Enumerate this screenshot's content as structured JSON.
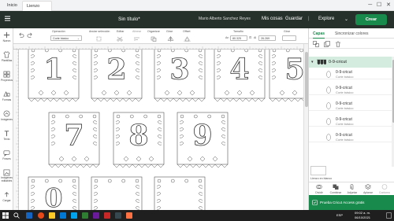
{
  "browser": {
    "tabs": [
      {
        "label": "Inicio"
      },
      {
        "label": "Lienzo"
      }
    ]
  },
  "header": {
    "title": "Sin título*",
    "my_projects": "Mis cosas",
    "save": "Guardar",
    "machine": "Explore",
    "make": "Crear",
    "user": "Mario Alberto Sanchez Reyes"
  },
  "colors": {
    "header_bg": "#26312b",
    "accent": "#188a4c",
    "selected_layer_bg": "#d4ecdf"
  },
  "toolbar": {
    "undo_icon": "undo-icon",
    "redo_icon": "redo-icon",
    "operation_label": "Operación",
    "operation_value": "Corte básico",
    "select_all": "Anular selección",
    "edit": "Editar",
    "align": "Alinear",
    "organize": "Organizar",
    "flip": "Girar",
    "offset": "Offset",
    "size_label": "Tamaño",
    "width_prefix": "An",
    "width_value": "80.325",
    "height_prefix": "Al",
    "height_value": "26.269",
    "rotate_label": "Girar"
  },
  "leftbar": {
    "items": [
      {
        "label": "Nuevo",
        "icon": "plus-icon"
      },
      {
        "label": "Plantillas",
        "icon": "shirt-icon"
      },
      {
        "label": "Proyectos",
        "icon": "grid-icon"
      },
      {
        "label": "Formas",
        "icon": "shapes-icon"
      },
      {
        "label": "Imágenes",
        "icon": "image-icon"
      },
      {
        "label": "Texto",
        "icon": "text-icon"
      },
      {
        "label": "Frases",
        "icon": "quote-icon"
      },
      {
        "label": "Imágenes editables",
        "icon": "editable-image-icon"
      },
      {
        "label": "Cargar",
        "icon": "upload-icon"
      }
    ]
  },
  "panel": {
    "tabs": [
      {
        "label": "Capas"
      },
      {
        "label": "Sincronizar colores"
      }
    ],
    "group_icon": "group-icon",
    "duplicate_icon": "duplicate-icon",
    "delete_icon": "trash-icon",
    "group_name": "0-9-cricut",
    "layers": [
      {
        "name": "0-9-cricut",
        "type": "Corte básico"
      },
      {
        "name": "0-9-cricut",
        "type": "Corte básico"
      },
      {
        "name": "0-9-cricut",
        "type": "Corte básico"
      },
      {
        "name": "0-9-cricut",
        "type": "Corte básico"
      },
      {
        "name": "0-9-cricut",
        "type": "Corte básico"
      }
    ],
    "blank_canvas": "Lienzo en blanco",
    "bottom_actions": [
      {
        "label": "Dividir",
        "icon": "slice-icon"
      },
      {
        "label": "Combinar",
        "icon": "combine-icon"
      },
      {
        "label": "Adjuntar",
        "icon": "attach-icon"
      },
      {
        "label": "Aplanar",
        "icon": "flatten-icon"
      },
      {
        "label": "Contorno",
        "icon": "contour-icon"
      }
    ],
    "access_banner": "Prueba Cricut Access gratis"
  },
  "canvas": {
    "tile_numbers_row1": [
      "1",
      "2",
      "3",
      "4",
      "5"
    ],
    "tile_numbers_row2": [
      "7",
      "8",
      "9"
    ],
    "tile_numbers_row3": [
      "0"
    ],
    "zoom": "50%"
  },
  "taskbar": {
    "search_icon": "windows-search-icon",
    "language": "ESP",
    "time": "09:02 a. m.",
    "date": "06/10/2021"
  }
}
